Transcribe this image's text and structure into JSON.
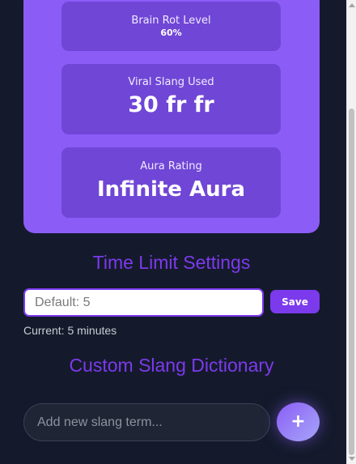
{
  "stats": {
    "brain_rot": {
      "label": "Brain Rot Level",
      "value": "60%",
      "percent": 60
    },
    "viral_slang": {
      "label": "Viral Slang Used",
      "value": "30 fr fr"
    },
    "aura": {
      "label": "Aura Rating",
      "value": "Infinite Aura"
    }
  },
  "time_limit": {
    "title": "Time Limit Settings",
    "input_placeholder": "Default: 5",
    "input_value": "",
    "save_label": "Save",
    "current_text": "Current: 5 minutes"
  },
  "slang_dictionary": {
    "title": "Custom Slang Dictionary",
    "input_placeholder": "Add new slang term...",
    "add_label": "+"
  },
  "colors": {
    "accent": "#7c3aed",
    "panel": "#8b5cf6",
    "card": "#7046d6",
    "background": "#141a2b"
  }
}
